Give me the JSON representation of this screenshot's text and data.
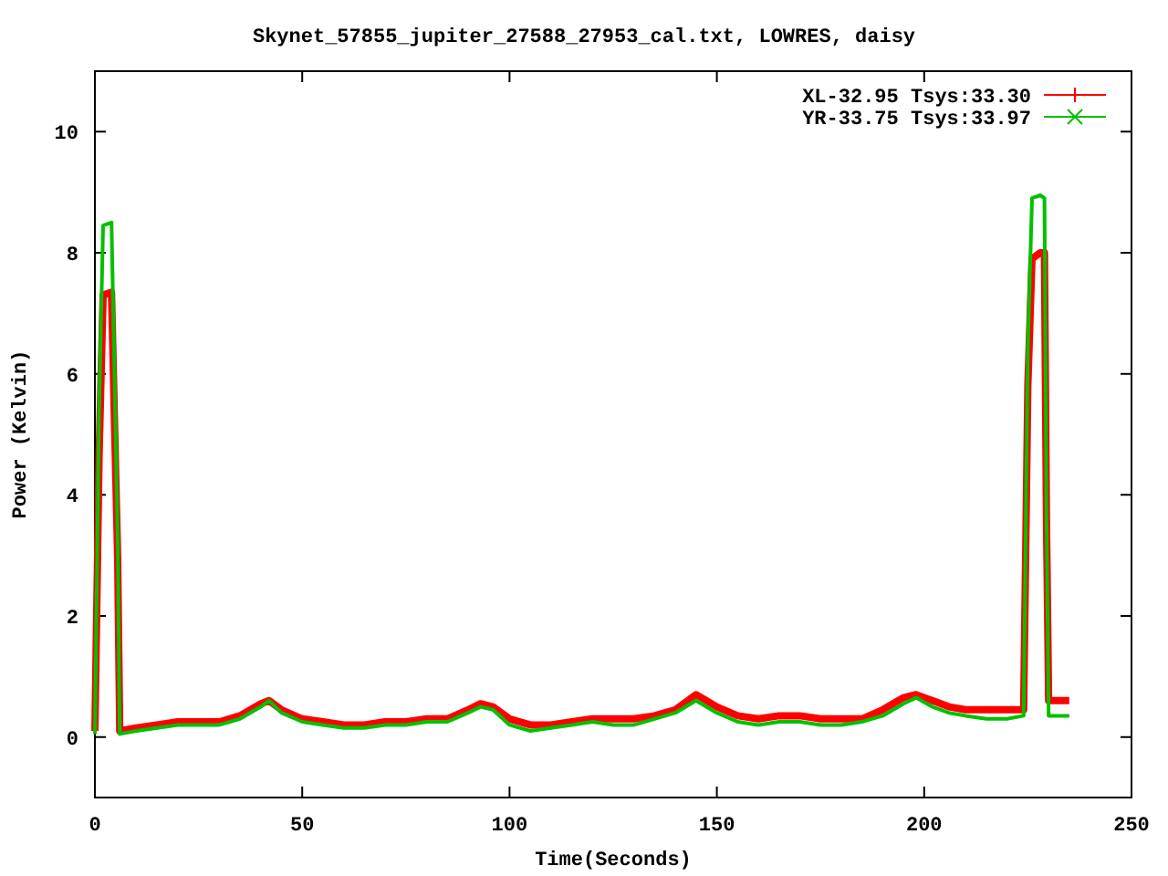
{
  "chart": {
    "chart_data": {
      "type": "line",
      "title": "Skynet_57855_jupiter_27588_27953_cal.txt, LOWRES, daisy",
      "xlabel": "Time(Seconds)",
      "ylabel": "Power (Kelvin)",
      "legend": true,
      "xlim": [
        0,
        250
      ],
      "ylim": [
        -1,
        11
      ],
      "xticks": [
        0,
        50,
        100,
        150,
        200,
        250
      ],
      "yticks": [
        0,
        2,
        4,
        6,
        8,
        10
      ],
      "x": [
        0,
        1,
        2,
        4,
        5.5,
        6,
        10,
        15,
        20,
        25,
        30,
        35,
        40,
        42,
        45,
        50,
        55,
        60,
        65,
        70,
        75,
        80,
        85,
        90,
        93,
        96,
        100,
        105,
        110,
        115,
        120,
        125,
        130,
        135,
        140,
        145,
        150,
        155,
        160,
        165,
        170,
        175,
        180,
        185,
        190,
        195,
        198,
        202,
        206,
        210,
        215,
        220,
        224,
        225,
        226,
        228,
        229,
        229.5,
        230,
        235
      ],
      "series": [
        {
          "name": "XL-32.95 Tsys:33.30",
          "color": "#ff0000",
          "values": [
            0.1,
            4.65,
            7.3,
            7.35,
            2.9,
            0.1,
            0.15,
            0.2,
            0.25,
            0.25,
            0.25,
            0.35,
            0.55,
            0.6,
            0.45,
            0.3,
            0.25,
            0.2,
            0.2,
            0.25,
            0.25,
            0.3,
            0.3,
            0.45,
            0.55,
            0.5,
            0.3,
            0.2,
            0.2,
            0.25,
            0.3,
            0.3,
            0.3,
            0.35,
            0.45,
            0.7,
            0.5,
            0.35,
            0.3,
            0.35,
            0.35,
            0.3,
            0.3,
            0.3,
            0.45,
            0.65,
            0.7,
            0.6,
            0.5,
            0.45,
            0.45,
            0.45,
            0.45,
            5.8,
            7.9,
            8.0,
            8.0,
            3.6,
            0.6,
            0.6
          ]
        },
        {
          "name": "YR-33.75 Tsys:33.97",
          "color": "#00c000",
          "values": [
            0.05,
            5.45,
            8.45,
            8.5,
            3.25,
            0.05,
            0.1,
            0.15,
            0.2,
            0.2,
            0.2,
            0.3,
            0.5,
            0.6,
            0.4,
            0.25,
            0.2,
            0.15,
            0.15,
            0.2,
            0.2,
            0.25,
            0.25,
            0.4,
            0.5,
            0.45,
            0.2,
            0.1,
            0.15,
            0.2,
            0.25,
            0.2,
            0.2,
            0.3,
            0.4,
            0.6,
            0.4,
            0.25,
            0.2,
            0.25,
            0.25,
            0.2,
            0.2,
            0.25,
            0.35,
            0.55,
            0.65,
            0.5,
            0.4,
            0.35,
            0.3,
            0.3,
            0.35,
            6.45,
            8.9,
            8.95,
            8.9,
            3.75,
            0.35,
            0.35
          ]
        }
      ]
    }
  }
}
